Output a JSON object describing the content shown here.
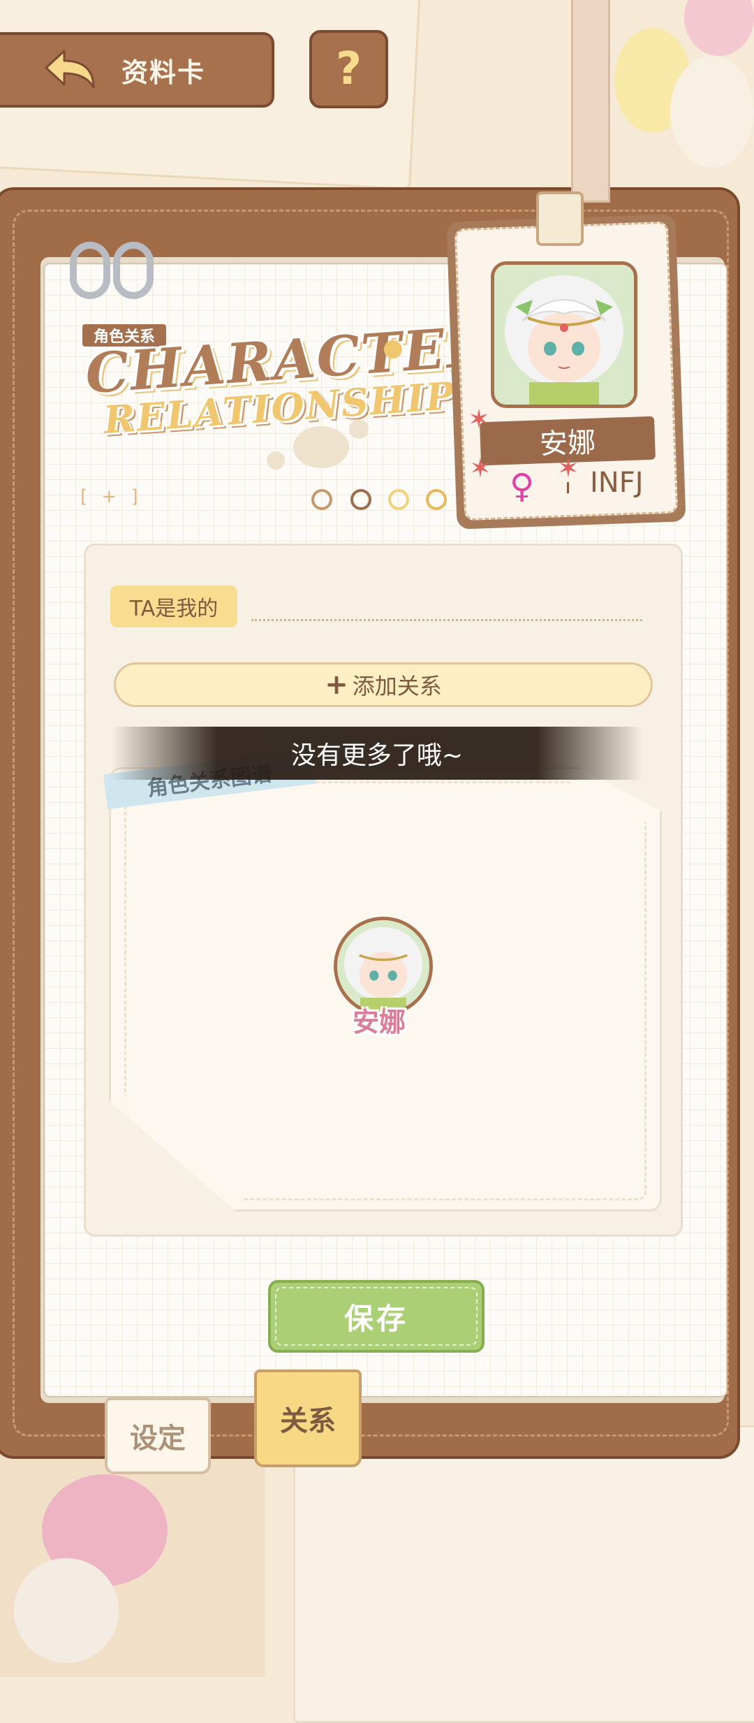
{
  "header": {
    "back_label": "资料卡",
    "help_label": "?"
  },
  "title_art": {
    "tag": "角色关系",
    "line1": "CHARACTER",
    "line2": "RELATIONSHIPS",
    "bracket": "[ + ]"
  },
  "profile": {
    "name": "安娜",
    "gender_symbol": "♀",
    "mbti": "INFJ"
  },
  "relation_form": {
    "ta_label": "TA是我的",
    "add_button": "添加关系",
    "add_icon": "plus-icon"
  },
  "toast": "没有更多了哦~",
  "graph": {
    "label": "角色关系图谱",
    "center_node_name": "安娜"
  },
  "save_button": "保存",
  "tabs": [
    {
      "label": "设定",
      "active": false
    },
    {
      "label": "关系",
      "active": true
    }
  ],
  "colors": {
    "brown": "#a7714e",
    "save_green": "#aacf75",
    "active_tab": "#f7d885",
    "gender_pink": "#e33fa9"
  }
}
